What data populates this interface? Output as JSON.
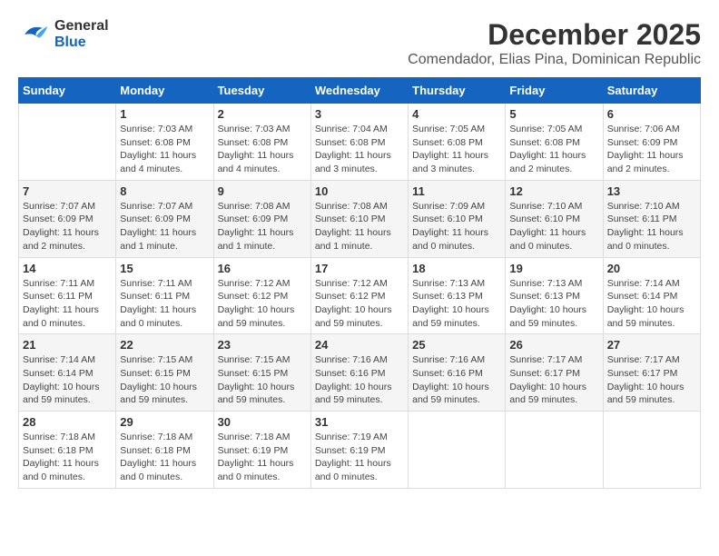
{
  "logo": {
    "line1": "General",
    "line2": "Blue"
  },
  "title": "December 2025",
  "subtitle": "Comendador, Elias Pina, Dominican Republic",
  "days_header": [
    "Sunday",
    "Monday",
    "Tuesday",
    "Wednesday",
    "Thursday",
    "Friday",
    "Saturday"
  ],
  "weeks": [
    [
      {
        "num": "",
        "info": ""
      },
      {
        "num": "1",
        "info": "Sunrise: 7:03 AM\nSunset: 6:08 PM\nDaylight: 11 hours and 4 minutes."
      },
      {
        "num": "2",
        "info": "Sunrise: 7:03 AM\nSunset: 6:08 PM\nDaylight: 11 hours and 4 minutes."
      },
      {
        "num": "3",
        "info": "Sunrise: 7:04 AM\nSunset: 6:08 PM\nDaylight: 11 hours and 3 minutes."
      },
      {
        "num": "4",
        "info": "Sunrise: 7:05 AM\nSunset: 6:08 PM\nDaylight: 11 hours and 3 minutes."
      },
      {
        "num": "5",
        "info": "Sunrise: 7:05 AM\nSunset: 6:08 PM\nDaylight: 11 hours and 2 minutes."
      },
      {
        "num": "6",
        "info": "Sunrise: 7:06 AM\nSunset: 6:09 PM\nDaylight: 11 hours and 2 minutes."
      }
    ],
    [
      {
        "num": "7",
        "info": "Sunrise: 7:07 AM\nSunset: 6:09 PM\nDaylight: 11 hours and 2 minutes."
      },
      {
        "num": "8",
        "info": "Sunrise: 7:07 AM\nSunset: 6:09 PM\nDaylight: 11 hours and 1 minute."
      },
      {
        "num": "9",
        "info": "Sunrise: 7:08 AM\nSunset: 6:09 PM\nDaylight: 11 hours and 1 minute."
      },
      {
        "num": "10",
        "info": "Sunrise: 7:08 AM\nSunset: 6:10 PM\nDaylight: 11 hours and 1 minute."
      },
      {
        "num": "11",
        "info": "Sunrise: 7:09 AM\nSunset: 6:10 PM\nDaylight: 11 hours and 0 minutes."
      },
      {
        "num": "12",
        "info": "Sunrise: 7:10 AM\nSunset: 6:10 PM\nDaylight: 11 hours and 0 minutes."
      },
      {
        "num": "13",
        "info": "Sunrise: 7:10 AM\nSunset: 6:11 PM\nDaylight: 11 hours and 0 minutes."
      }
    ],
    [
      {
        "num": "14",
        "info": "Sunrise: 7:11 AM\nSunset: 6:11 PM\nDaylight: 11 hours and 0 minutes."
      },
      {
        "num": "15",
        "info": "Sunrise: 7:11 AM\nSunset: 6:11 PM\nDaylight: 11 hours and 0 minutes."
      },
      {
        "num": "16",
        "info": "Sunrise: 7:12 AM\nSunset: 6:12 PM\nDaylight: 10 hours and 59 minutes."
      },
      {
        "num": "17",
        "info": "Sunrise: 7:12 AM\nSunset: 6:12 PM\nDaylight: 10 hours and 59 minutes."
      },
      {
        "num": "18",
        "info": "Sunrise: 7:13 AM\nSunset: 6:13 PM\nDaylight: 10 hours and 59 minutes."
      },
      {
        "num": "19",
        "info": "Sunrise: 7:13 AM\nSunset: 6:13 PM\nDaylight: 10 hours and 59 minutes."
      },
      {
        "num": "20",
        "info": "Sunrise: 7:14 AM\nSunset: 6:14 PM\nDaylight: 10 hours and 59 minutes."
      }
    ],
    [
      {
        "num": "21",
        "info": "Sunrise: 7:14 AM\nSunset: 6:14 PM\nDaylight: 10 hours and 59 minutes."
      },
      {
        "num": "22",
        "info": "Sunrise: 7:15 AM\nSunset: 6:15 PM\nDaylight: 10 hours and 59 minutes."
      },
      {
        "num": "23",
        "info": "Sunrise: 7:15 AM\nSunset: 6:15 PM\nDaylight: 10 hours and 59 minutes."
      },
      {
        "num": "24",
        "info": "Sunrise: 7:16 AM\nSunset: 6:16 PM\nDaylight: 10 hours and 59 minutes."
      },
      {
        "num": "25",
        "info": "Sunrise: 7:16 AM\nSunset: 6:16 PM\nDaylight: 10 hours and 59 minutes."
      },
      {
        "num": "26",
        "info": "Sunrise: 7:17 AM\nSunset: 6:17 PM\nDaylight: 10 hours and 59 minutes."
      },
      {
        "num": "27",
        "info": "Sunrise: 7:17 AM\nSunset: 6:17 PM\nDaylight: 10 hours and 59 minutes."
      }
    ],
    [
      {
        "num": "28",
        "info": "Sunrise: 7:18 AM\nSunset: 6:18 PM\nDaylight: 11 hours and 0 minutes."
      },
      {
        "num": "29",
        "info": "Sunrise: 7:18 AM\nSunset: 6:18 PM\nDaylight: 11 hours and 0 minutes."
      },
      {
        "num": "30",
        "info": "Sunrise: 7:18 AM\nSunset: 6:19 PM\nDaylight: 11 hours and 0 minutes."
      },
      {
        "num": "31",
        "info": "Sunrise: 7:19 AM\nSunset: 6:19 PM\nDaylight: 11 hours and 0 minutes."
      },
      {
        "num": "",
        "info": ""
      },
      {
        "num": "",
        "info": ""
      },
      {
        "num": "",
        "info": ""
      }
    ]
  ]
}
